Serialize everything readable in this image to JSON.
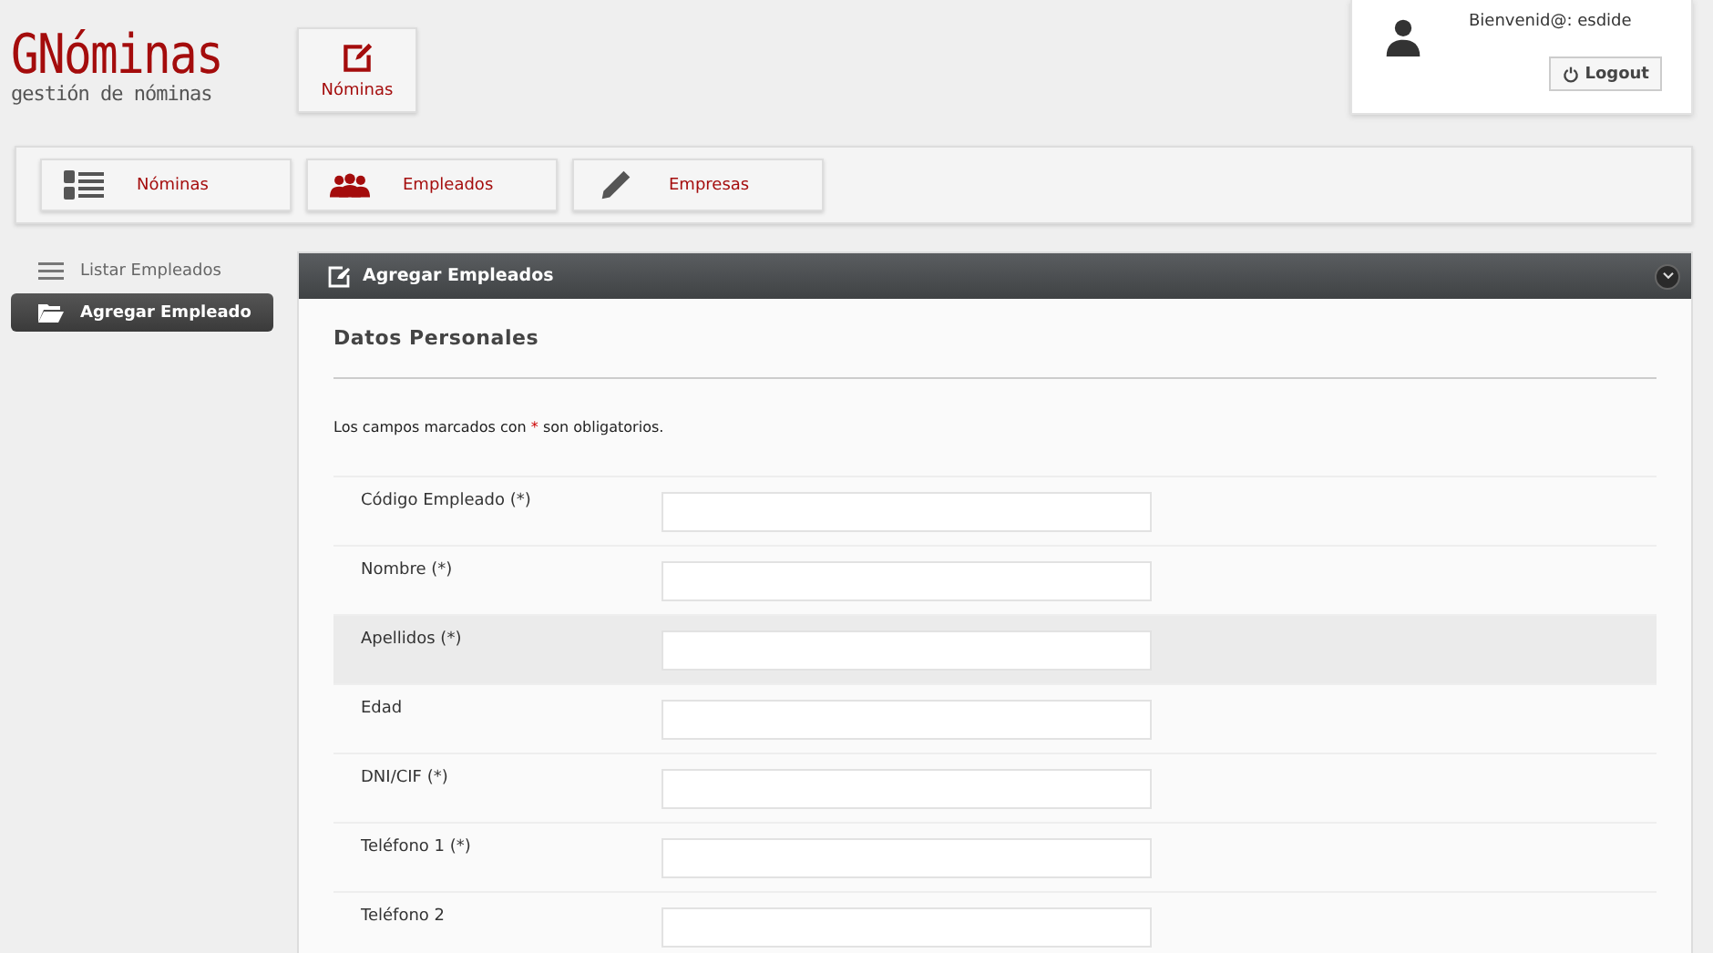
{
  "logo": {
    "title": "GNóminas",
    "subtitle": "gestión de nóminas"
  },
  "top_button": {
    "label": "Nóminas"
  },
  "user": {
    "greeting": "Bienvenid@: esdide",
    "logout": "Logout"
  },
  "nav": [
    {
      "kind": "list",
      "label": "Nóminas"
    },
    {
      "kind": "people",
      "label": "Empleados"
    },
    {
      "kind": "pencil",
      "label": "Empresas"
    }
  ],
  "sidebar": {
    "items": [
      {
        "kind": "list",
        "label": "Listar Empleados",
        "selected": false
      },
      {
        "kind": "folder",
        "label": "Agregar Empleado",
        "selected": true
      }
    ]
  },
  "panel": {
    "title": "Agregar Empleados",
    "section": "Datos Personales",
    "notice": {
      "before": "Los campos marcados con",
      "mark": "*",
      "after": "son obligatorios."
    },
    "fields": [
      {
        "label": "Código Empleado (*)",
        "highlighted": false
      },
      {
        "label": "Nombre (*)",
        "highlighted": false
      },
      {
        "label": "Apellidos (*)",
        "highlighted": true
      },
      {
        "label": "Edad",
        "highlighted": false
      },
      {
        "label": "DNI/CIF (*)",
        "highlighted": false
      },
      {
        "label": "Teléfono 1 (*)",
        "highlighted": false
      },
      {
        "label": "Teléfono 2",
        "highlighted": false
      }
    ]
  }
}
